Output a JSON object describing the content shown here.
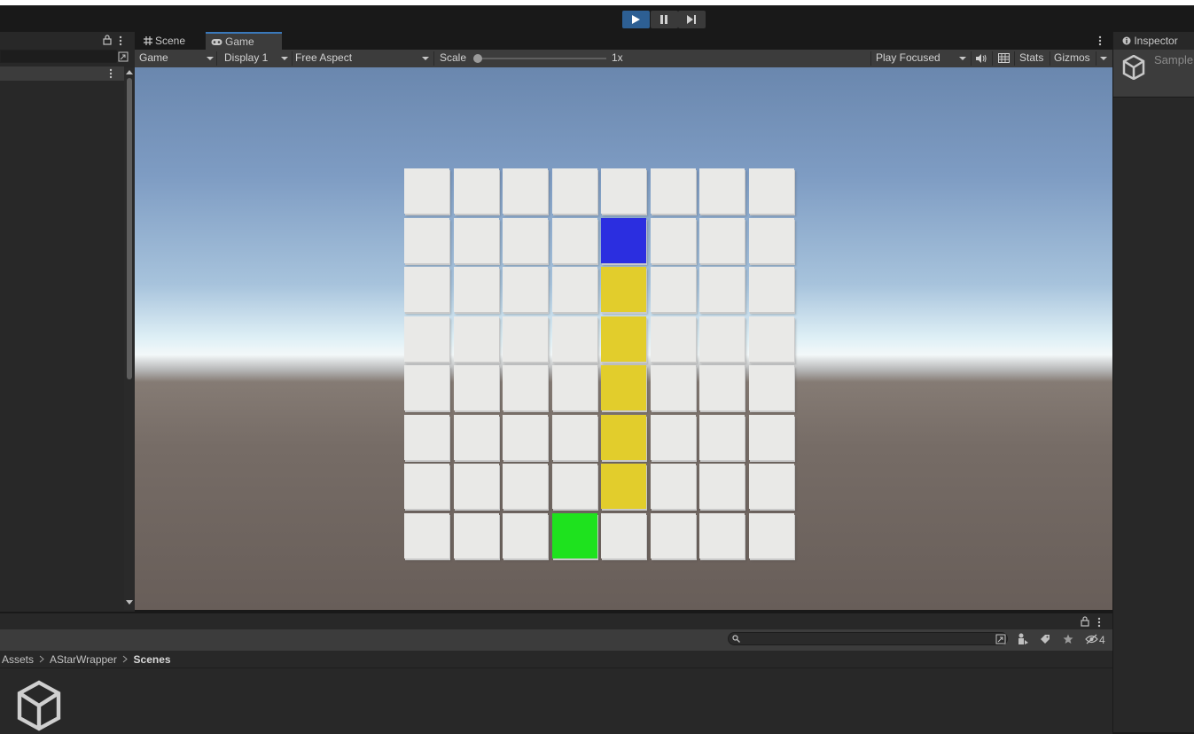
{
  "window": {
    "top_strip_text": ""
  },
  "toolbar": {
    "play": "play",
    "pause": "pause",
    "step": "step"
  },
  "game_tabs": [
    {
      "label": "Scene",
      "icon": "grid-icon"
    },
    {
      "label": "Game",
      "icon": "gamepad-icon"
    }
  ],
  "game_toolbar": {
    "mode": "Game",
    "display": "Display 1",
    "aspect": "Free Aspect",
    "scale_label": "Scale",
    "scale_value": "1x",
    "play_mode": "Play Focused",
    "stats": "Stats",
    "gizmos": "Gizmos"
  },
  "grid": {
    "rows": 8,
    "cols": 8,
    "tile_color": "#e9e9e7",
    "colored_cells": [
      {
        "row": 1,
        "col": 4,
        "color": "#2b2ee0",
        "role": "start"
      },
      {
        "row": 2,
        "col": 4,
        "color": "#e2cd2c",
        "role": "path"
      },
      {
        "row": 3,
        "col": 4,
        "color": "#e2cd2c",
        "role": "path"
      },
      {
        "row": 4,
        "col": 4,
        "color": "#e2cd2c",
        "role": "path"
      },
      {
        "row": 5,
        "col": 4,
        "color": "#e2cd2c",
        "role": "path"
      },
      {
        "row": 6,
        "col": 4,
        "color": "#e2cd2c",
        "role": "path"
      },
      {
        "row": 7,
        "col": 3,
        "color": "#1ee21e",
        "role": "goal"
      }
    ]
  },
  "inspector": {
    "tab_label": "Inspector",
    "object_name": "Sample"
  },
  "project": {
    "breadcrumb": [
      "Assets",
      "AStarWrapper",
      "Scenes"
    ],
    "hidden_count": "4"
  },
  "colors": {
    "accent": "#3a79bb",
    "play_active": "#2d5f93"
  }
}
